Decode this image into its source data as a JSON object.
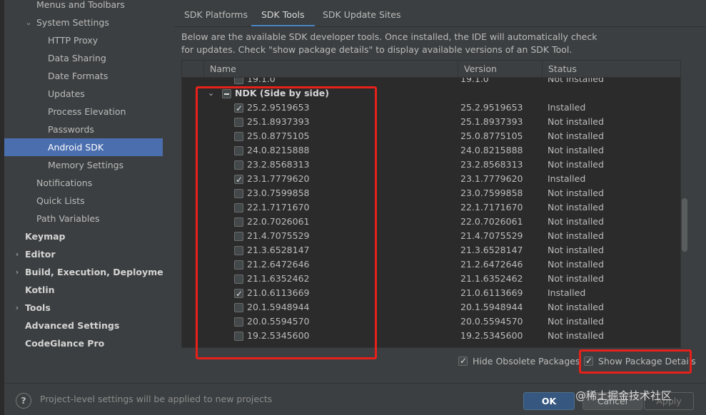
{
  "sidebar": {
    "items": [
      {
        "label": "Menus and Toolbars",
        "indent": 2,
        "bold": false,
        "selected": false,
        "arrow": ""
      },
      {
        "label": "System Settings",
        "indent": 2,
        "bold": false,
        "selected": false,
        "arrow": "open"
      },
      {
        "label": "HTTP Proxy",
        "indent": 3,
        "bold": false,
        "selected": false,
        "arrow": ""
      },
      {
        "label": "Data Sharing",
        "indent": 3,
        "bold": false,
        "selected": false,
        "arrow": ""
      },
      {
        "label": "Date Formats",
        "indent": 3,
        "bold": false,
        "selected": false,
        "arrow": ""
      },
      {
        "label": "Updates",
        "indent": 3,
        "bold": false,
        "selected": false,
        "arrow": ""
      },
      {
        "label": "Process Elevation",
        "indent": 3,
        "bold": false,
        "selected": false,
        "arrow": ""
      },
      {
        "label": "Passwords",
        "indent": 3,
        "bold": false,
        "selected": false,
        "arrow": ""
      },
      {
        "label": "Android SDK",
        "indent": 3,
        "bold": false,
        "selected": true,
        "arrow": ""
      },
      {
        "label": "Memory Settings",
        "indent": 3,
        "bold": false,
        "selected": false,
        "arrow": ""
      },
      {
        "label": "Notifications",
        "indent": 2,
        "bold": false,
        "selected": false,
        "arrow": ""
      },
      {
        "label": "Quick Lists",
        "indent": 2,
        "bold": false,
        "selected": false,
        "arrow": ""
      },
      {
        "label": "Path Variables",
        "indent": 2,
        "bold": false,
        "selected": false,
        "arrow": ""
      },
      {
        "label": "Keymap",
        "indent": 1,
        "bold": true,
        "selected": false,
        "arrow": ""
      },
      {
        "label": "Editor",
        "indent": 1,
        "bold": true,
        "selected": false,
        "arrow": "closed"
      },
      {
        "label": "Build, Execution, Deployment",
        "indent": 1,
        "bold": true,
        "selected": false,
        "arrow": "closed"
      },
      {
        "label": "Kotlin",
        "indent": 1,
        "bold": true,
        "selected": false,
        "arrow": ""
      },
      {
        "label": "Tools",
        "indent": 1,
        "bold": true,
        "selected": false,
        "arrow": "closed"
      },
      {
        "label": "Advanced Settings",
        "indent": 1,
        "bold": true,
        "selected": false,
        "arrow": ""
      },
      {
        "label": "CodeGlance Pro",
        "indent": 1,
        "bold": true,
        "selected": false,
        "arrow": ""
      }
    ]
  },
  "tabs": [
    {
      "label": "SDK Platforms",
      "active": false
    },
    {
      "label": "SDK Tools",
      "active": true
    },
    {
      "label": "SDK Update Sites",
      "active": false
    }
  ],
  "description": "Below are the available SDK developer tools. Once installed, the IDE will automatically check for updates. Check \"show package details\" to display available versions of an SDK Tool.",
  "table": {
    "columns": [
      "Name",
      "Version",
      "Status"
    ],
    "rows": [
      {
        "name": "19.1.0",
        "version": "19.1.0",
        "status": "Not installed",
        "checked": false,
        "group": false
      },
      {
        "name": "NDK (Side by side)",
        "version": "",
        "status": "",
        "checked": "partial",
        "group": true
      },
      {
        "name": "25.2.9519653",
        "version": "25.2.9519653",
        "status": "Installed",
        "checked": true,
        "group": false
      },
      {
        "name": "25.1.8937393",
        "version": "25.1.8937393",
        "status": "Not installed",
        "checked": false,
        "group": false
      },
      {
        "name": "25.0.8775105",
        "version": "25.0.8775105",
        "status": "Not installed",
        "checked": false,
        "group": false
      },
      {
        "name": "24.0.8215888",
        "version": "24.0.8215888",
        "status": "Not installed",
        "checked": false,
        "group": false
      },
      {
        "name": "23.2.8568313",
        "version": "23.2.8568313",
        "status": "Not installed",
        "checked": false,
        "group": false
      },
      {
        "name": "23.1.7779620",
        "version": "23.1.7779620",
        "status": "Installed",
        "checked": true,
        "group": false
      },
      {
        "name": "23.0.7599858",
        "version": "23.0.7599858",
        "status": "Not installed",
        "checked": false,
        "group": false
      },
      {
        "name": "22.1.7171670",
        "version": "22.1.7171670",
        "status": "Not installed",
        "checked": false,
        "group": false
      },
      {
        "name": "22.0.7026061",
        "version": "22.0.7026061",
        "status": "Not installed",
        "checked": false,
        "group": false
      },
      {
        "name": "21.4.7075529",
        "version": "21.4.7075529",
        "status": "Not installed",
        "checked": false,
        "group": false
      },
      {
        "name": "21.3.6528147",
        "version": "21.3.6528147",
        "status": "Not installed",
        "checked": false,
        "group": false
      },
      {
        "name": "21.2.6472646",
        "version": "21.2.6472646",
        "status": "Not installed",
        "checked": false,
        "group": false
      },
      {
        "name": "21.1.6352462",
        "version": "21.1.6352462",
        "status": "Not installed",
        "checked": false,
        "group": false
      },
      {
        "name": "21.0.6113669",
        "version": "21.0.6113669",
        "status": "Installed",
        "checked": true,
        "group": false
      },
      {
        "name": "20.1.5948944",
        "version": "20.1.5948944",
        "status": "Not installed",
        "checked": false,
        "group": false
      },
      {
        "name": "20.0.5594570",
        "version": "20.0.5594570",
        "status": "Not installed",
        "checked": false,
        "group": false
      },
      {
        "name": "19.2.5345600",
        "version": "19.2.5345600",
        "status": "Not installed",
        "checked": false,
        "group": false
      }
    ]
  },
  "options": {
    "hide_obsolete": {
      "label": "Hide Obsolete Packages",
      "checked": true
    },
    "show_details": {
      "label": "Show Package Details",
      "checked": true
    }
  },
  "footer": {
    "help": "?",
    "hint": "Project-level settings will be applied to new projects",
    "ok": "OK",
    "cancel": "Cancel",
    "apply": "Apply",
    "watermark": "@稀土掘金技术社区"
  },
  "colors": {
    "highlight": "#e8201a",
    "selection": "#4b6eaf",
    "primary_button": "#365880"
  }
}
